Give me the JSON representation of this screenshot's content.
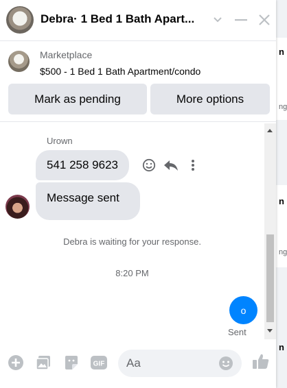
{
  "header": {
    "title": "Debra· 1 Bed 1 Bath Apart..."
  },
  "marketplace": {
    "label": "Marketplace",
    "item": "$500 - 1 Bed 1 Bath Apartment/condo",
    "pending_button": "Mark as pending",
    "options_button": "More options"
  },
  "messages": {
    "sender": "Urown",
    "bubble1": "541 258 9623",
    "bubble2": "Message sent",
    "waiting": "Debra is waiting for your response.",
    "time": "8:20 PM",
    "sent_bubble_text": "o",
    "sent_status": "Sent"
  },
  "composer": {
    "placeholder": "Aa"
  },
  "background_page": {
    "letters": [
      "n",
      "ng",
      "n",
      "ng",
      "n"
    ]
  },
  "colors": {
    "accent": "#0084ff",
    "bubble": "#e4e6eb",
    "icon": "#bcc0c4"
  }
}
